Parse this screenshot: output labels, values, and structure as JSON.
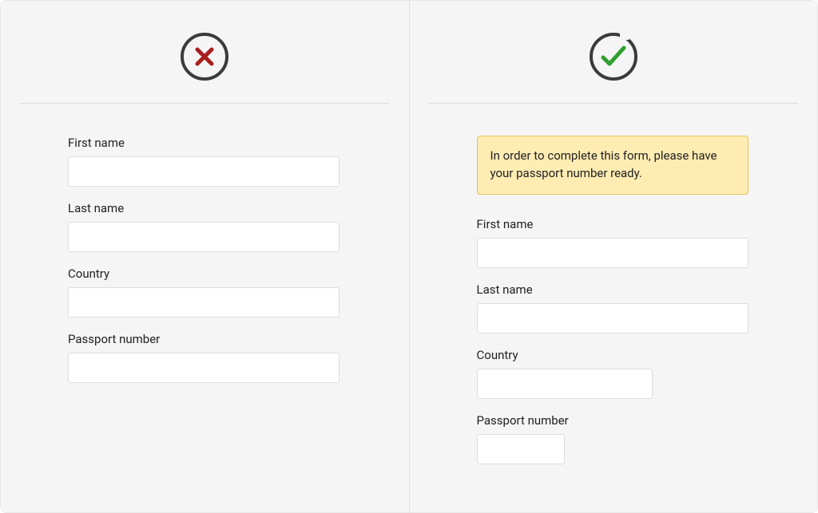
{
  "left": {
    "icon": "cross",
    "fields": {
      "first_name": {
        "label": "First name",
        "value": ""
      },
      "last_name": {
        "label": "Last name",
        "value": ""
      },
      "country": {
        "label": "Country",
        "value": ""
      },
      "passport": {
        "label": "Passport number",
        "value": ""
      }
    }
  },
  "right": {
    "icon": "check",
    "notice": "In order to complete this form, please have your passport number ready.",
    "fields": {
      "first_name": {
        "label": "First name",
        "value": ""
      },
      "last_name": {
        "label": "Last name",
        "value": ""
      },
      "country": {
        "label": "Country",
        "value": ""
      },
      "passport": {
        "label": "Passport number",
        "value": ""
      }
    }
  },
  "colors": {
    "cross": "#aa1e1e",
    "check": "#2f9e2f",
    "notice_bg": "#ffecb3",
    "notice_border": "#e6c25a"
  }
}
